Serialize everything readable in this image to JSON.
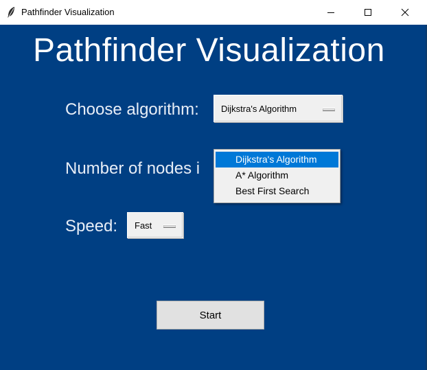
{
  "window": {
    "title": "Pathfinder Visualization",
    "controls": {
      "minimize": "minimize-icon",
      "maximize": "maximize-icon",
      "close": "close-icon"
    }
  },
  "app": {
    "heading": "Pathfinder Visualization",
    "algorithm": {
      "label": "Choose algorithm:",
      "selected": "Dijkstra's Algorithm",
      "options": [
        "Dijkstra's Algorithm",
        "A* Algorithm",
        "Best First Search"
      ]
    },
    "nodes": {
      "label": "Number of nodes i",
      "selected": ""
    },
    "speed": {
      "label": "Speed:",
      "selected": "Fast"
    },
    "start_label": "Start"
  },
  "colors": {
    "background": "#003f83",
    "menu_highlight": "#0078d7"
  }
}
